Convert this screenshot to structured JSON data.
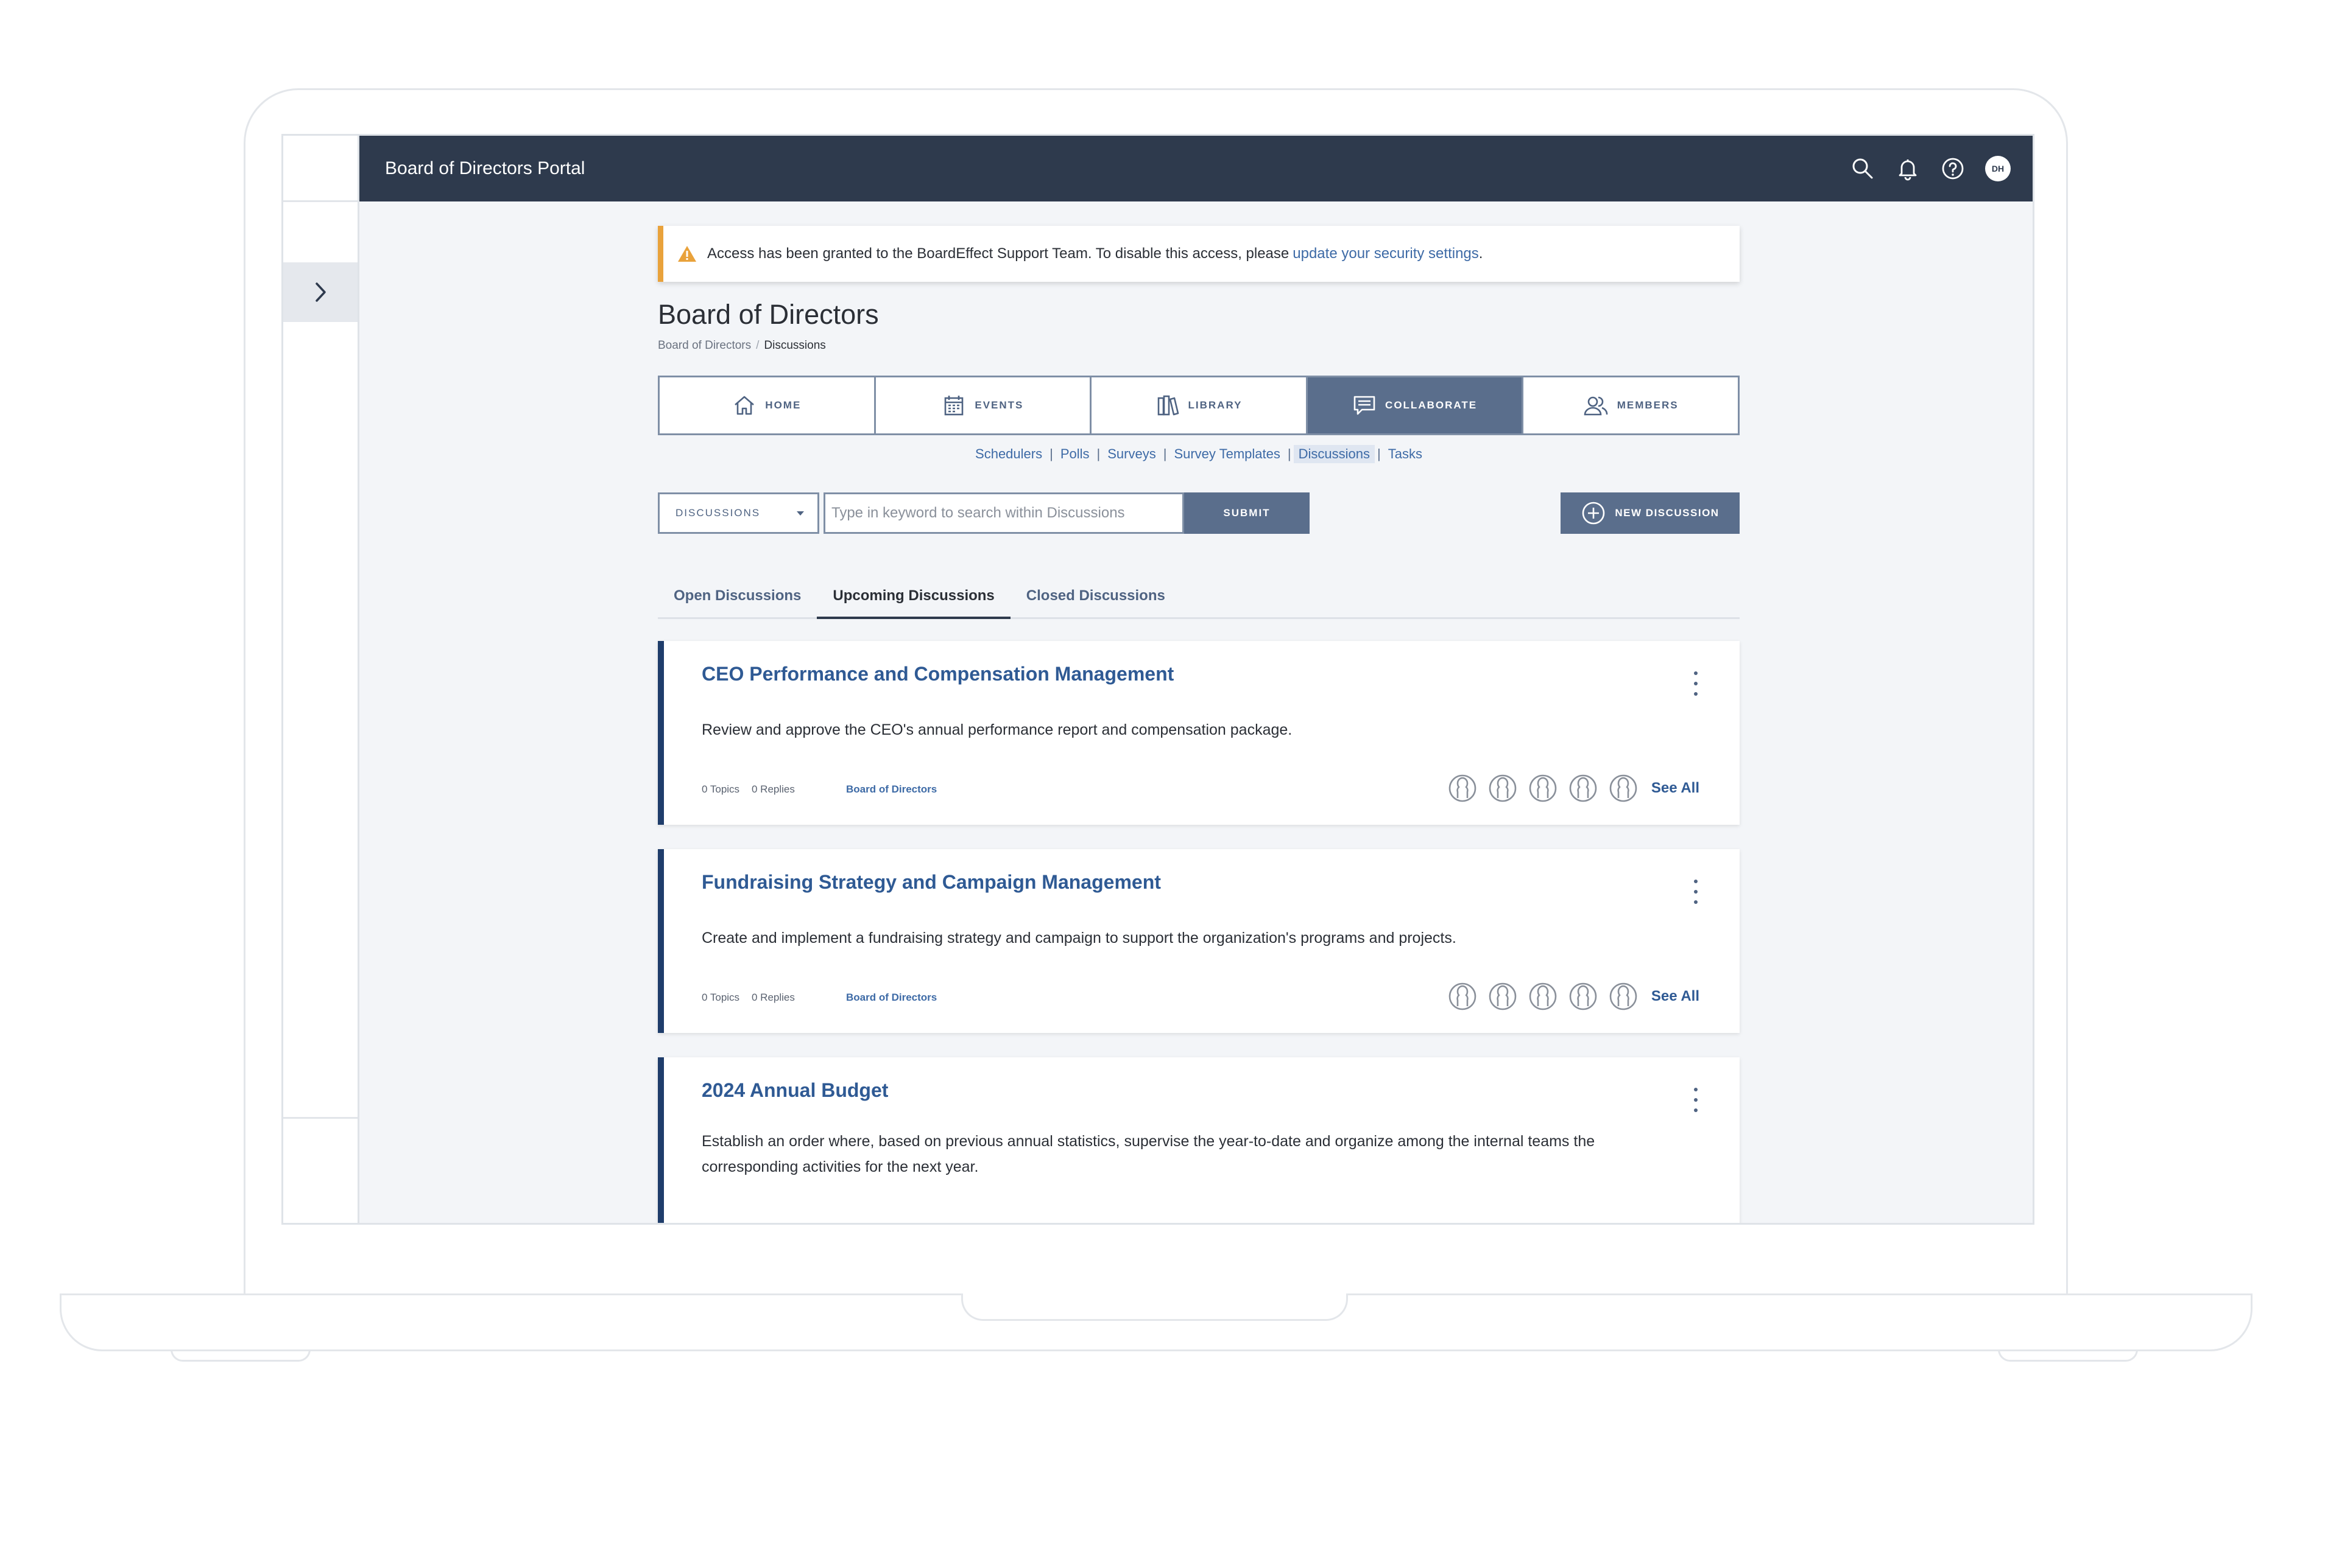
{
  "app": {
    "portal_title": "Board of Directors Portal",
    "avatar_initials": "DH"
  },
  "alert": {
    "text": "Access has been granted to the BoardEffect Support Team. To disable this access, please",
    "link": "update your security settings",
    "suffix": "."
  },
  "page": {
    "title": "Board of Directors",
    "breadcrumb": [
      "Board of Directors",
      "/",
      "Discussions"
    ]
  },
  "main_tabs": [
    {
      "label": "HOME",
      "icon": "home-icon"
    },
    {
      "label": "EVENTS",
      "icon": "calendar-icon"
    },
    {
      "label": "LIBRARY",
      "icon": "library-icon"
    },
    {
      "label": "COLLABORATE",
      "icon": "chat-icon",
      "active": true
    },
    {
      "label": "MEMBERS",
      "icon": "members-icon"
    }
  ],
  "sub_nav": [
    "Schedulers",
    "Polls",
    "Surveys",
    "Survey Templates",
    "Discussions",
    "Tasks"
  ],
  "sub_nav_active": "Discussions",
  "toolbar": {
    "select_value": "DISCUSSIONS",
    "search_placeholder": "Type in keyword to search within Discussions",
    "submit_label": "SUBMIT",
    "new_label": "NEW DISCUSSION"
  },
  "tabs": [
    {
      "label": "Open Discussions"
    },
    {
      "label": "Upcoming Discussions",
      "active": true
    },
    {
      "label": "Closed Discussions"
    }
  ],
  "discussions": [
    {
      "title": "CEO Performance and Compensation Management",
      "description": "Review and approve the CEO's annual performance report and compensation package.",
      "topics": "0 Topics",
      "replies": "0 Replies",
      "group": "Board of Directors",
      "see_all": "See All"
    },
    {
      "title": "Fundraising Strategy and Campaign Management",
      "description": "Create and implement a fundraising strategy and campaign to support the organization's programs and projects.",
      "topics": "0 Topics",
      "replies": "0 Replies",
      "group": "Board of Directors",
      "see_all": "See All"
    },
    {
      "title": "2024 Annual Budget",
      "description": "Establish an order where, based on previous annual statistics, supervise the year-to-date and organize among the internal teams the corresponding activities for the next year."
    }
  ],
  "colors": {
    "topbar": "#2e3a4d",
    "accent": "#5a6e8c",
    "link": "#2f5a94",
    "alert_accent": "#e9a23b",
    "card_accent": "#1f3d6b"
  }
}
